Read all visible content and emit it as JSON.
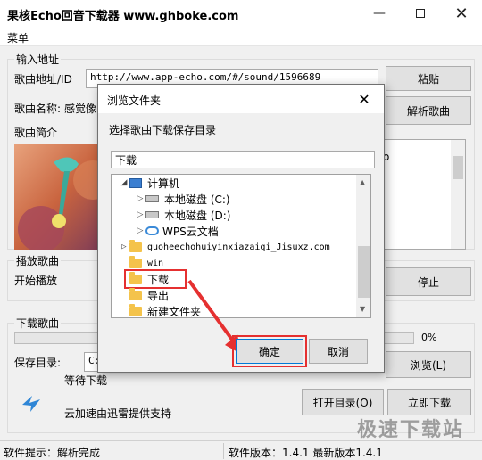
{
  "window": {
    "title": "果核Echo回音下载器 www.ghboke.com"
  },
  "menu": {
    "label": "菜单"
  },
  "input_section": {
    "group_label": "输入地址",
    "url_label": "歌曲地址/ID",
    "url_value": "http://www.app-echo.com/#/sound/1596689",
    "paste_button": "粘贴",
    "name_label": "歌曲名称:",
    "name_value": "感觉像",
    "parse_button": "解析歌曲",
    "intro_label": "歌曲简介",
    "intro_text_tail": "o"
  },
  "play_section": {
    "group_label": "播放歌曲",
    "start_label": "开始播放",
    "stop_button": "停止"
  },
  "download_section": {
    "group_label": "下载歌曲",
    "progress_percent": "0%",
    "progress_value": 0,
    "save_dir_label": "保存目录:",
    "save_dir_value": "C:",
    "browse_button": "浏览(L)",
    "status_wait": "等待下载",
    "open_dir_button": "打开目录(O)",
    "download_now_button": "立即下载",
    "cloud_note": "云加速由迅雷提供支持"
  },
  "statusbar": {
    "tip": "软件提示：解析完成",
    "version": "软件版本：1.4.1 最新版本1.4.1"
  },
  "dialog": {
    "title": "浏览文件夹",
    "prompt": "选择歌曲下载保存目录",
    "folder_value": "下载",
    "tree": [
      {
        "label": "计算机",
        "level": 0,
        "expander": "◢",
        "icon": "computer-icon"
      },
      {
        "label": "本地磁盘 (C:)",
        "level": 1,
        "expander": "▷",
        "icon": "drive-icon"
      },
      {
        "label": "本地磁盘 (D:)",
        "level": 1,
        "expander": "▷",
        "icon": "drive-icon"
      },
      {
        "label": "WPS云文档",
        "level": 1,
        "expander": "▷",
        "icon": "cloud-icon"
      },
      {
        "label": "guoheechohuiyinxiazaiqi_Jisuxz.com",
        "level": 0,
        "expander": "▷",
        "icon": "folder-icon"
      },
      {
        "label": "win",
        "level": 0,
        "expander": "",
        "icon": "folder-icon"
      },
      {
        "label": "下载",
        "level": 0,
        "expander": "",
        "icon": "folder-icon",
        "selected": true
      },
      {
        "label": "导出",
        "level": 0,
        "expander": "",
        "icon": "folder-icon"
      },
      {
        "label": "新建文件夹",
        "level": 0,
        "expander": "",
        "icon": "folder-icon"
      }
    ],
    "ok_button": "确定",
    "cancel_button": "取消"
  },
  "watermark": "极速下载站",
  "colors": {
    "highlight_red": "#e53030",
    "folder": "#f4c34b",
    "window_bg": "#f0f0f0"
  }
}
